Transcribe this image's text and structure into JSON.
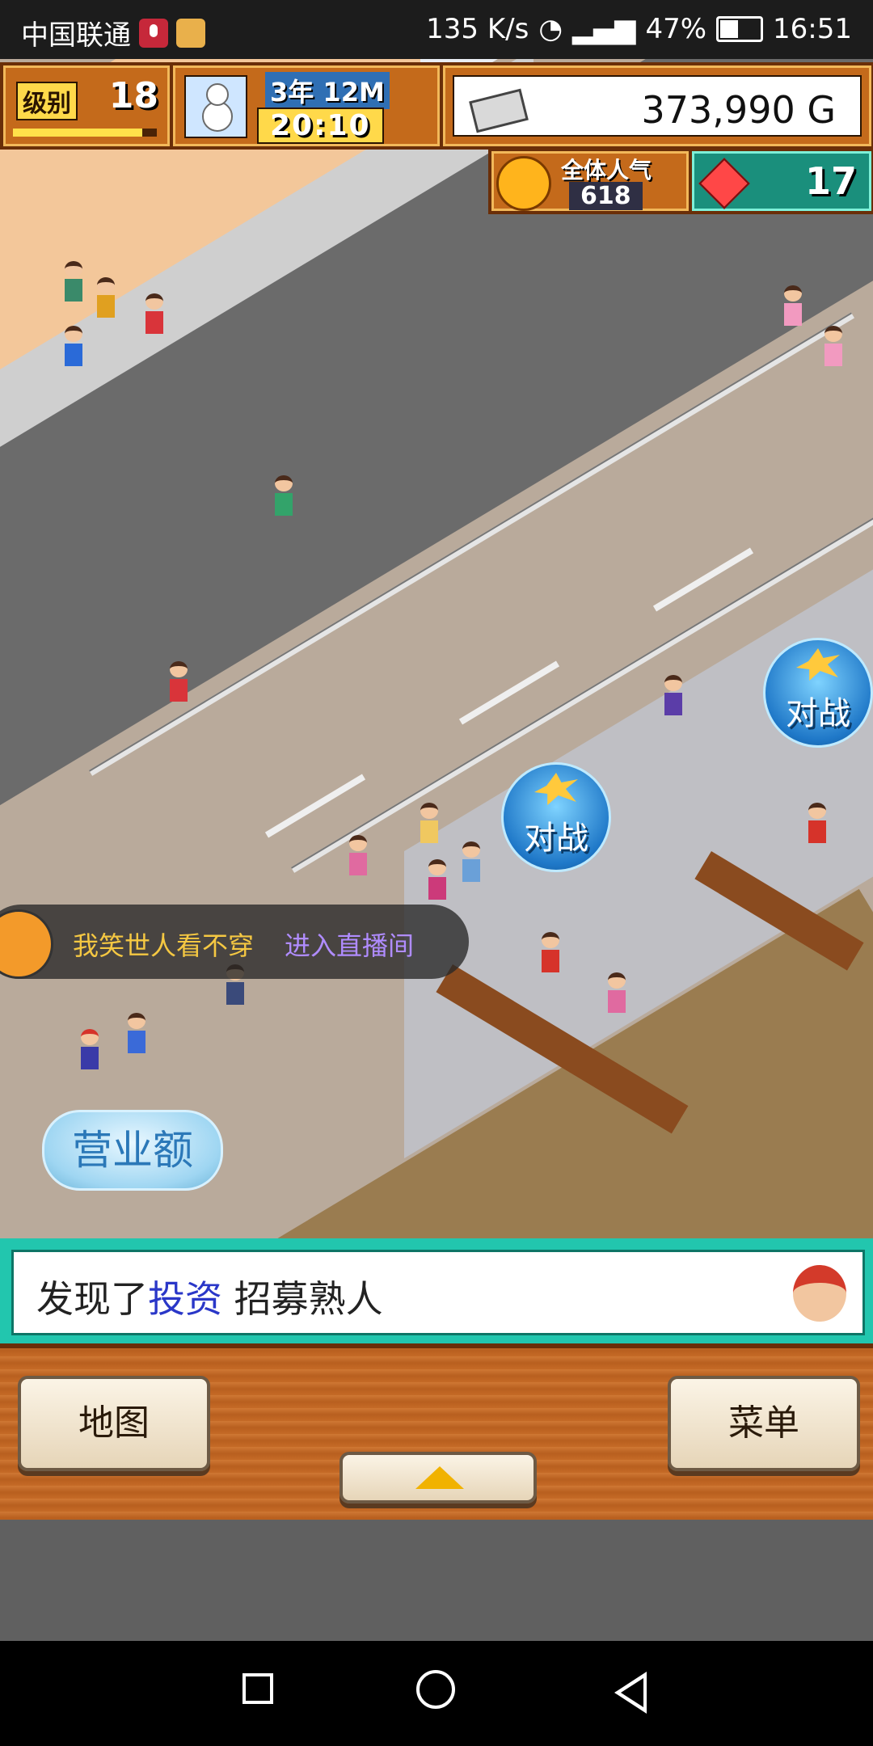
{
  "status_bar": {
    "carrier": "中国联通",
    "speed": "135 K/s",
    "battery": "47%",
    "time": "16:51"
  },
  "hud": {
    "level_label": "级别",
    "level": "18",
    "level_progress": 0.9,
    "year": "3年",
    "month": "12M",
    "clock": "20:10",
    "money": "373,990 G",
    "popularity_label": "全体人气",
    "popularity": "618",
    "rank": "17"
  },
  "scene": {
    "battle_label": "对战",
    "live_user": "我笑世人看不穿",
    "live_link": "进入直播间",
    "revenue_button": "营业额"
  },
  "message": {
    "prefix": "发现了",
    "link": "投资",
    "suffix": " 招募熟人"
  },
  "buttons": {
    "map": "地图",
    "menu": "菜单"
  },
  "colors": {
    "hud_orange": "#c46a1b",
    "message_teal": "#22c6ae",
    "wood": "#c56a26",
    "link_blue": "#2a37c8"
  }
}
